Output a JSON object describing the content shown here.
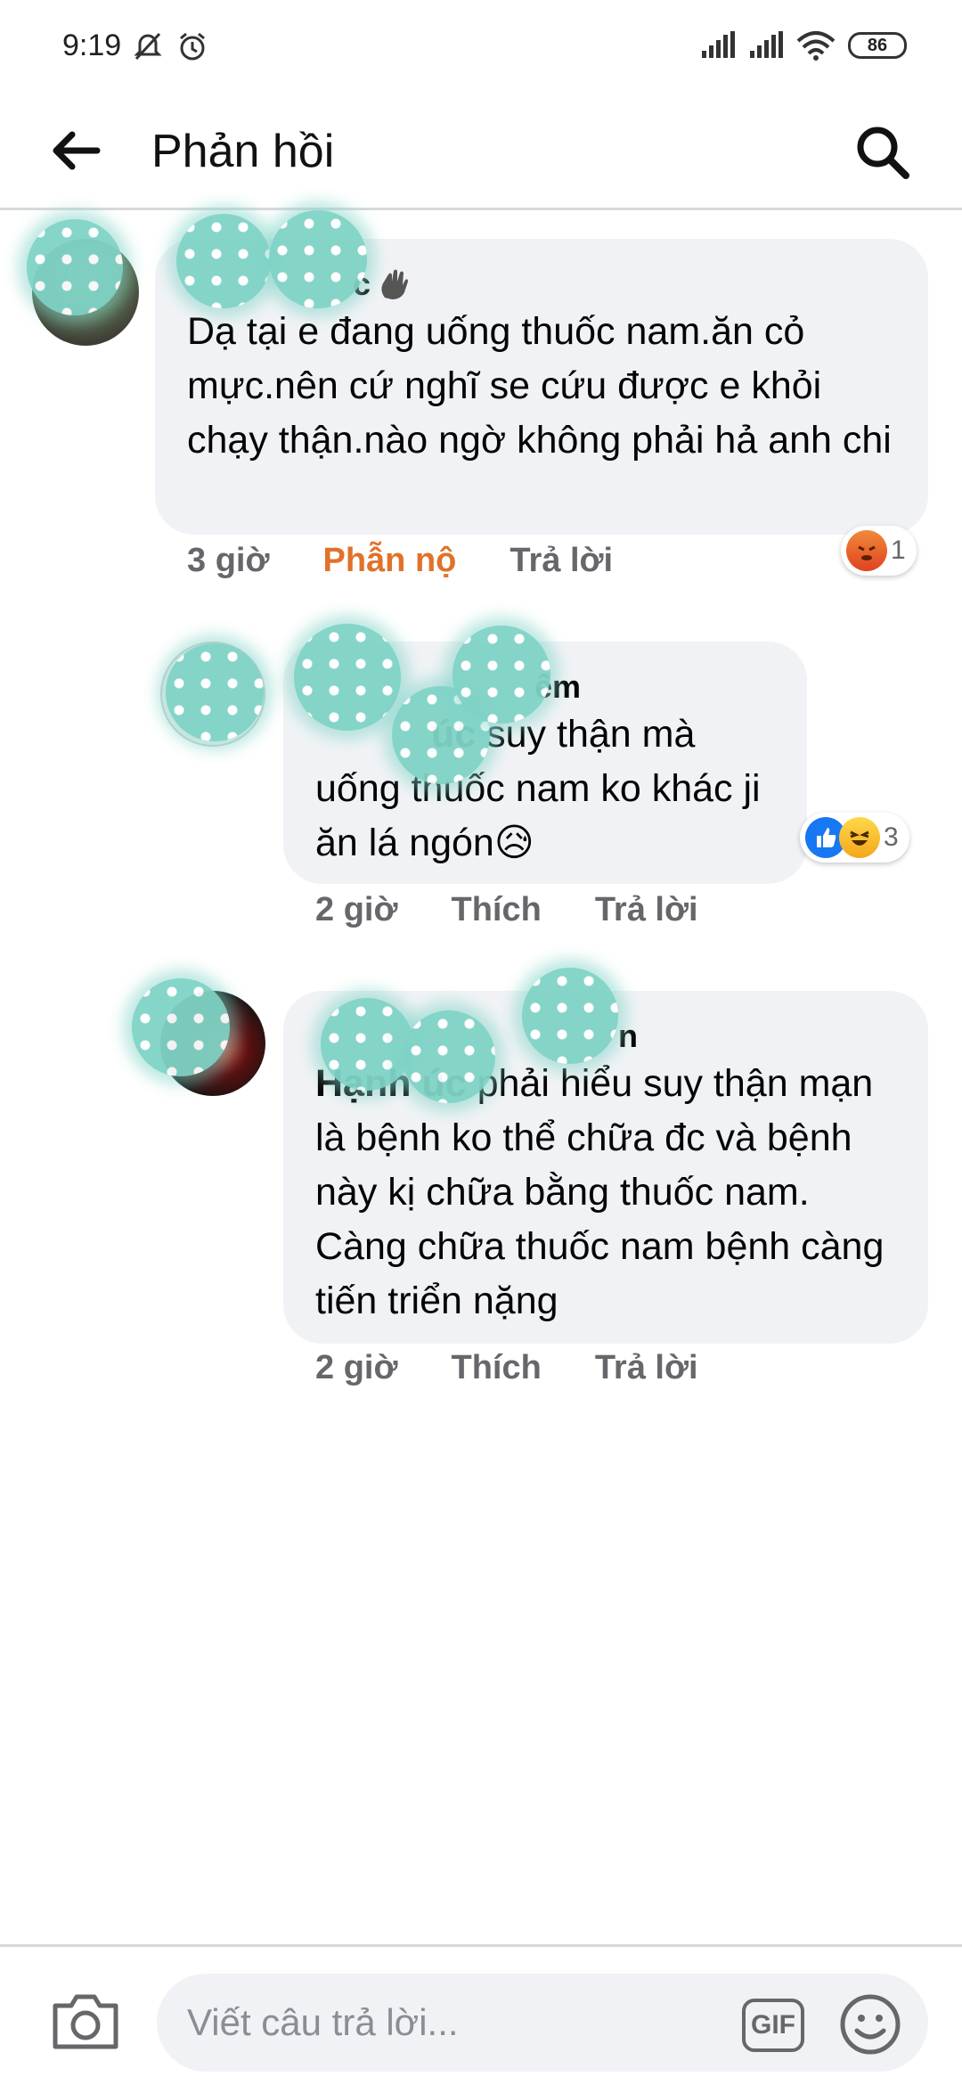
{
  "status_bar": {
    "time": "9:19",
    "battery": "86"
  },
  "header": {
    "title": "Phản hồi"
  },
  "comments": [
    {
      "author": "c",
      "text": "Dạ tại e đang uống thuốc nam.ăn cỏ mực.nên cứ nghĩ se cứu được e khỏi chạy thận.nào ngờ không phải hả anh chi",
      "time": "3 giờ",
      "reaction_label": "Phẫn nộ",
      "reply_label": "Trả lời",
      "reactions": {
        "icons": [
          "angry-react"
        ],
        "count": "1"
      }
    },
    {
      "author": "êm",
      "mention": "úc",
      "text": " suy thận mà uống thuốc nam ko khác ji ăn lá ngón😥",
      "time": "2 giờ",
      "like_label": "Thích",
      "reply_label": "Trả lời",
      "reactions": {
        "icons": [
          "like-react",
          "haha-react"
        ],
        "count": "3"
      }
    },
    {
      "author": "n",
      "mention": "Hạnh   úc",
      "text": " phải hiểu suy thận mạn là bệnh ko thể chữa đc và bệnh này kị chữa bằng thuốc nam. Càng chữa thuốc nam bệnh càng tiến triển nặng",
      "time": "2 giờ",
      "like_label": "Thích",
      "reply_label": "Trả lời"
    }
  ],
  "composer": {
    "placeholder": "Viết câu trả lời...",
    "gif_label": "GIF"
  },
  "colors": {
    "accent_reaction": "#e0722a",
    "bubble": "#f0f2f5",
    "meta": "#65676b",
    "like_blue": "#1877f2"
  }
}
